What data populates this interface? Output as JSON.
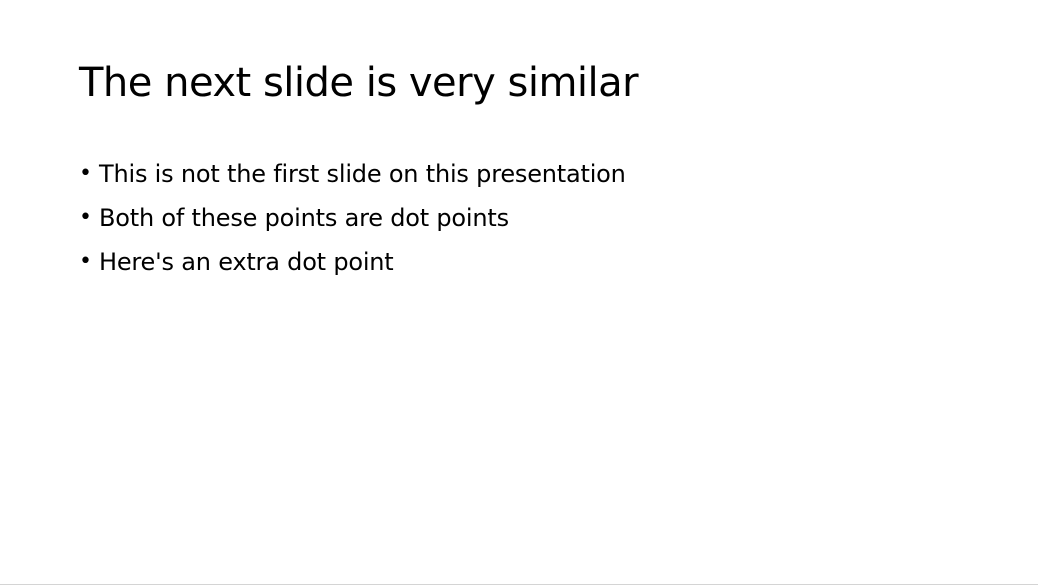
{
  "slide": {
    "title": "The next slide is very similar",
    "bullet_char": "•",
    "bullets": [
      "This is not the first slide on this presentation",
      "Both of these points are dot points",
      "Here's an extra dot point"
    ]
  }
}
